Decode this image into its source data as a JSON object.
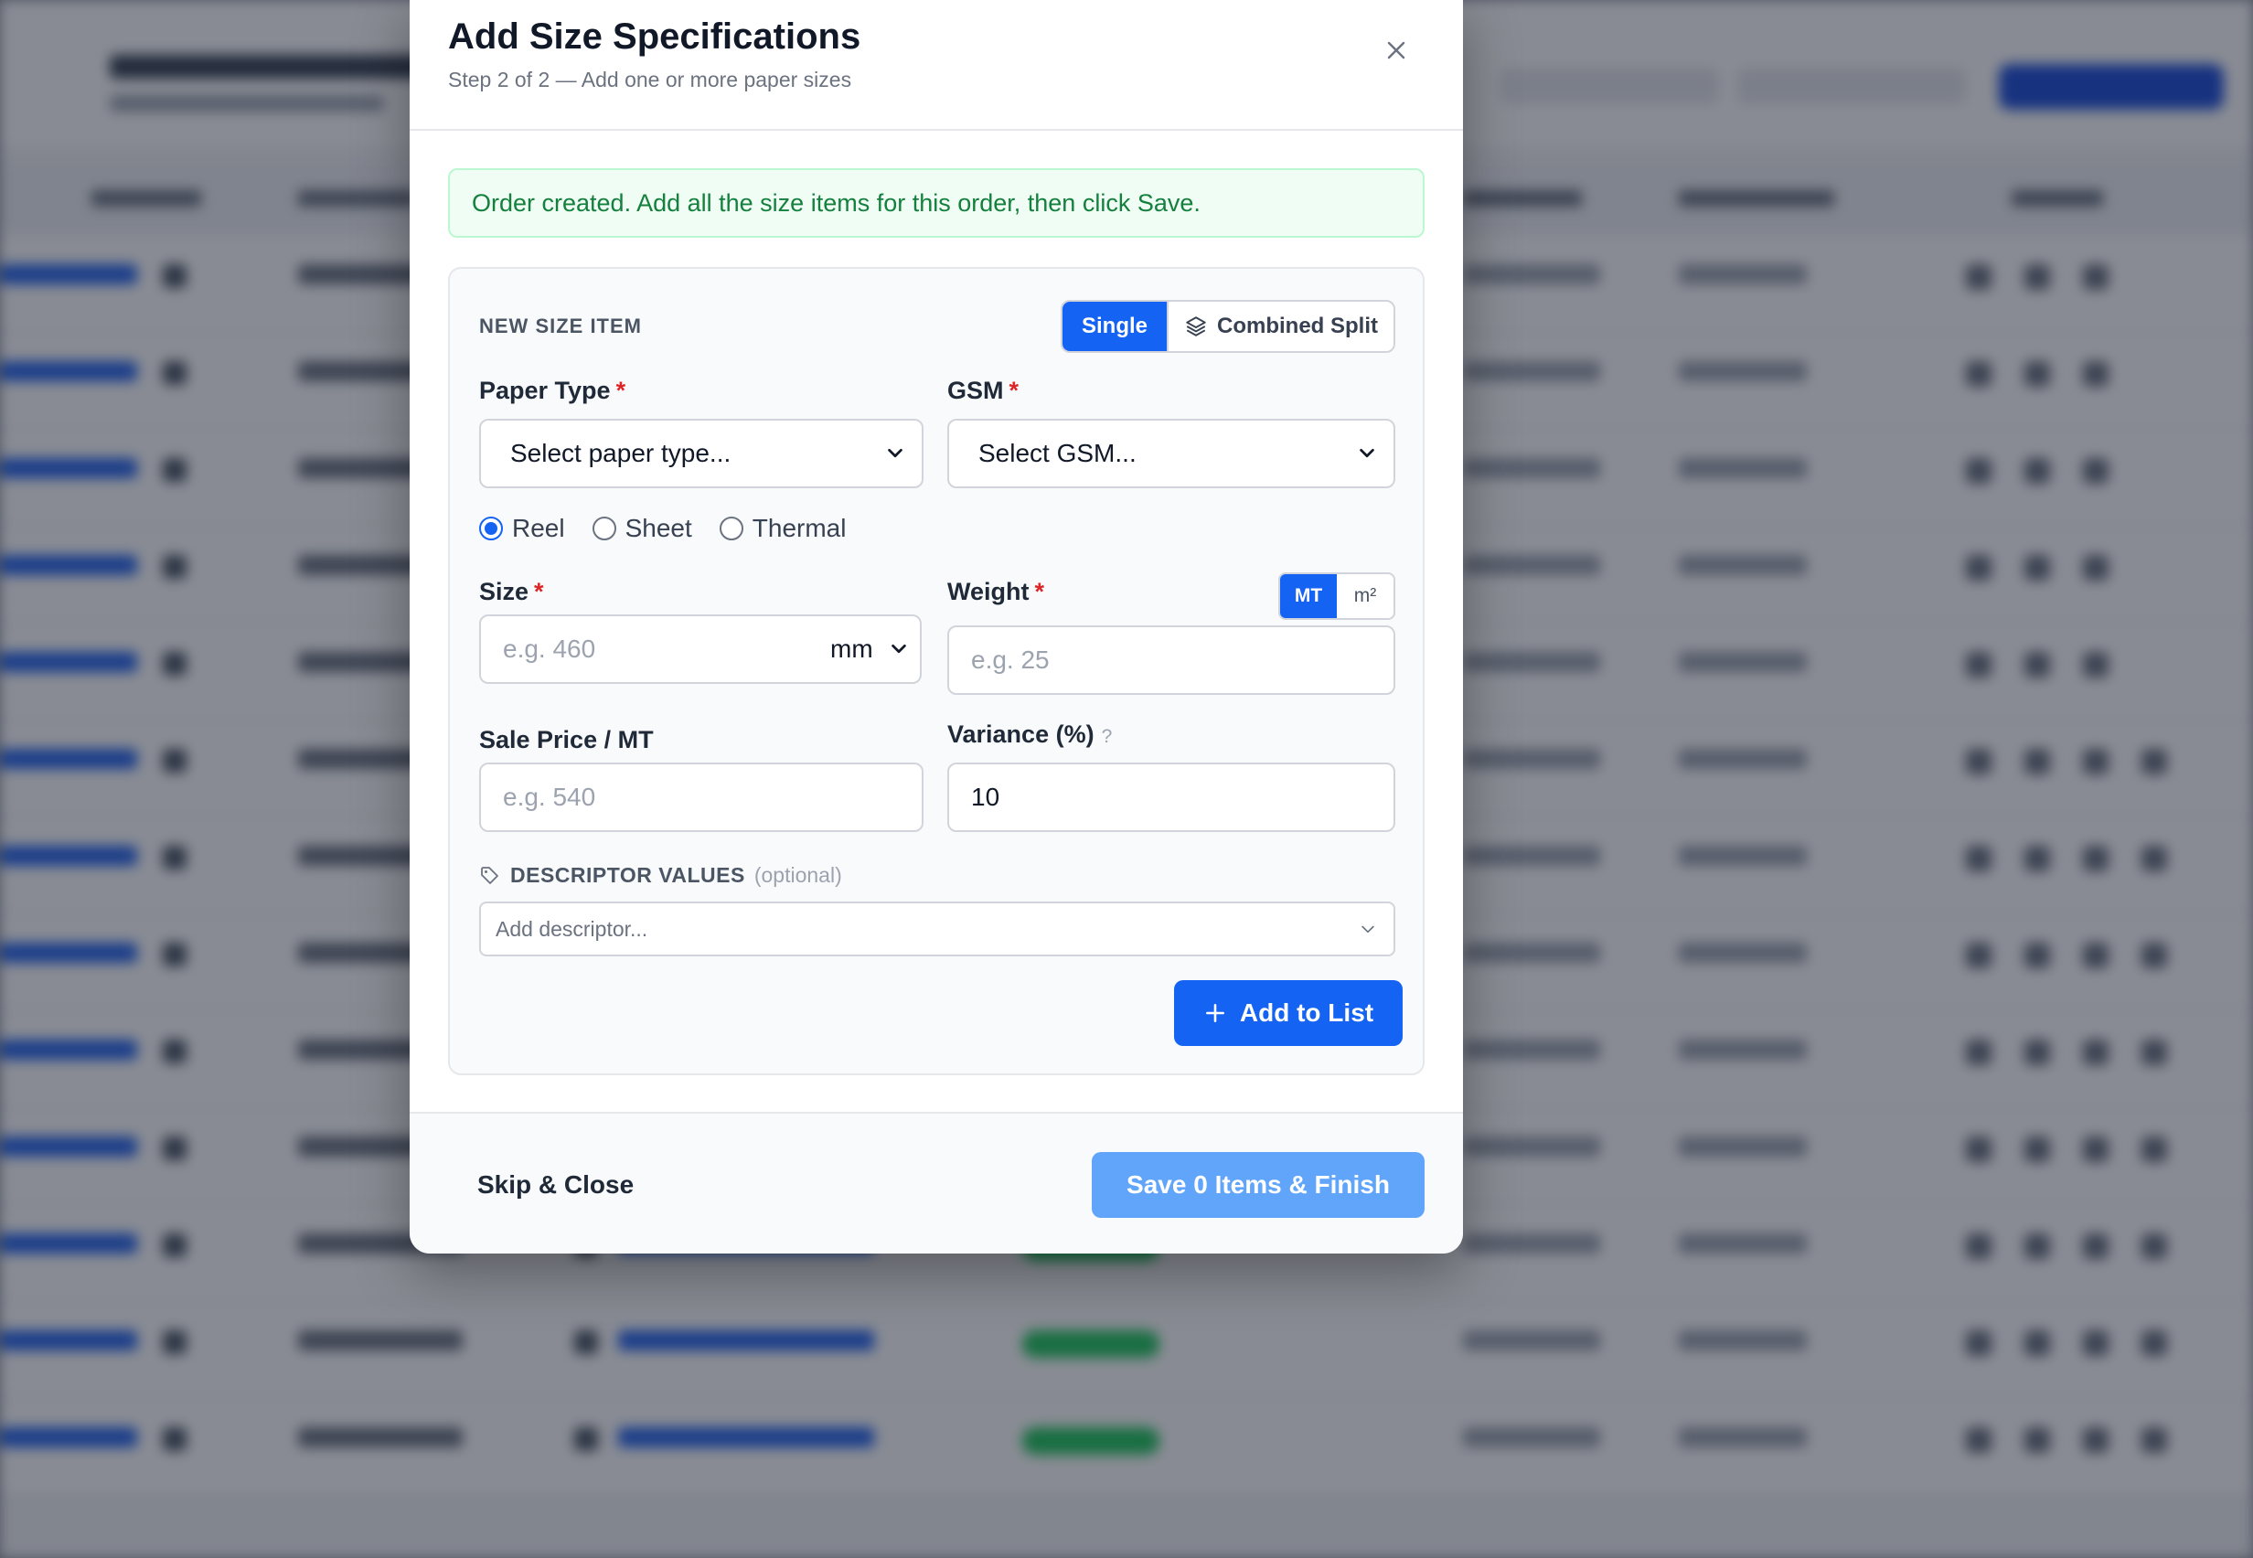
{
  "modal": {
    "title": "Add Size Specifications",
    "subtitle": "Step 2 of 2 — Add one or more paper sizes",
    "alert": "Order created. Add all the size items for this order, then click Save."
  },
  "card": {
    "section_label": "NEW SIZE ITEM",
    "mode": {
      "single": "Single",
      "combined": "Combined Split",
      "selected": "Single"
    }
  },
  "fields": {
    "paper_type": {
      "label": "Paper Type",
      "required": "*",
      "value": "Select paper type..."
    },
    "gsm": {
      "label": "GSM",
      "required": "*",
      "value": "Select GSM..."
    },
    "form": {
      "options": [
        "Reel",
        "Sheet",
        "Thermal"
      ],
      "selected": "Reel"
    },
    "size": {
      "label": "Size",
      "required": "*",
      "placeholder": "e.g. 460",
      "unit": "mm"
    },
    "weight": {
      "label": "Weight",
      "required": "*",
      "placeholder": "e.g. 25",
      "unit_mt": "MT",
      "unit_m2": "m²"
    },
    "sale_price": {
      "label": "Sale Price / MT",
      "placeholder": "e.g. 540"
    },
    "variance": {
      "label": "Variance (%)",
      "help": "?",
      "value": "10"
    },
    "descriptor": {
      "label": "DESCRIPTOR VALUES",
      "optional": "(optional)",
      "placeholder": "Add descriptor..."
    }
  },
  "buttons": {
    "add_to_list": "Add to List",
    "skip": "Skip & Close",
    "save": "Save 0 Items & Finish"
  },
  "colors": {
    "primary": "#1463f3",
    "save_disabled": "#60a5fa",
    "success_text": "#15803d",
    "required": "#dc2626"
  }
}
